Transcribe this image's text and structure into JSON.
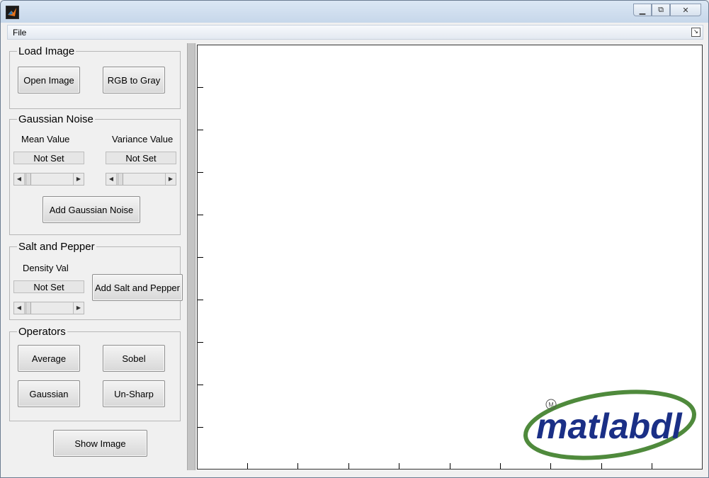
{
  "window": {
    "minimize_icon": "minimize-icon",
    "maximize_icon": "maximize-icon",
    "close_icon": "close-icon"
  },
  "menubar": {
    "file_label": "File"
  },
  "load_image": {
    "title": "Load Image",
    "open_label": "Open Image",
    "gray_label": "RGB to Gray"
  },
  "gaussian_noise": {
    "title": "Gaussian Noise",
    "mean_label": "Mean  Value",
    "variance_label": "Variance  Value",
    "mean_value": "Not Set",
    "variance_value": "Not Set",
    "add_label": "Add Gaussian Noise"
  },
  "salt_pepper": {
    "title": "Salt and Pepper",
    "density_label": "Density  Val",
    "density_value": "Not Set",
    "add_label": "Add Salt and Pepper"
  },
  "operators": {
    "title": "Operators",
    "average_label": "Average",
    "sobel_label": "Sobel",
    "gaussian_label": "Gaussian",
    "unsharp_label": "Un-Sharp"
  },
  "show_label": "Show Image",
  "watermark": {
    "text": "matlabdl",
    "mark": "M"
  },
  "colors": {
    "logo_blue": "#1a2f86",
    "logo_green": "#4f8a3c"
  }
}
